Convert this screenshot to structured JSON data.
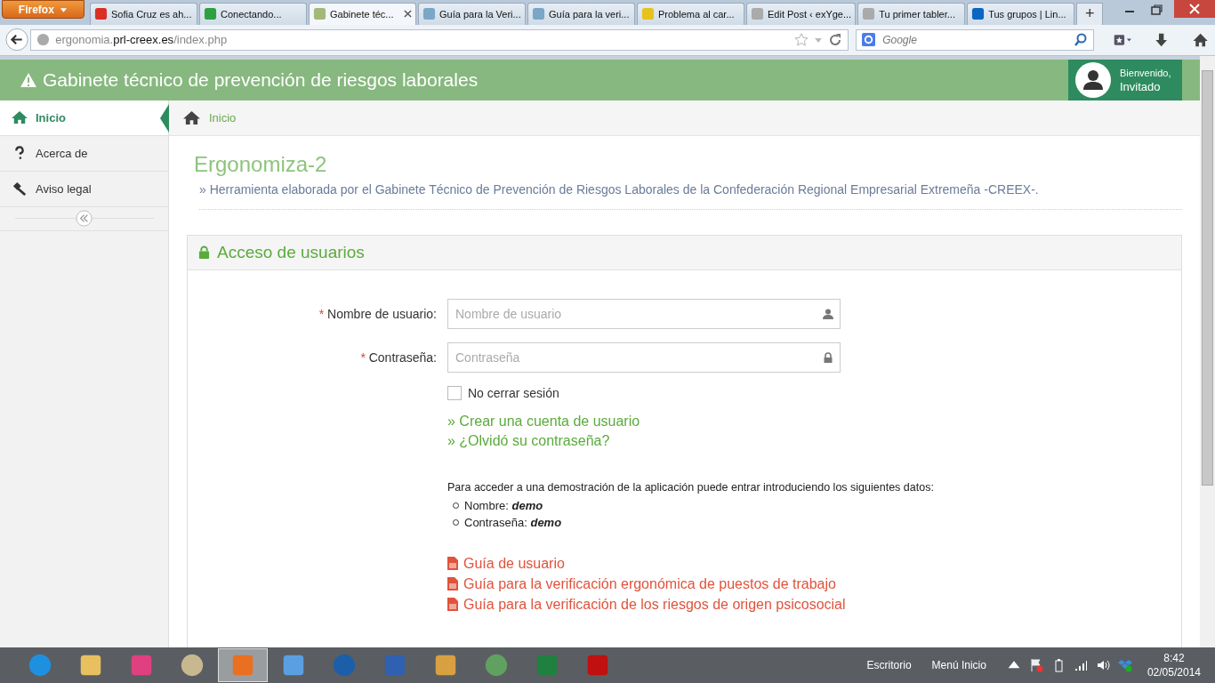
{
  "browser": {
    "menu_button": "Firefox",
    "tabs": [
      {
        "title": "Sofia Cruz es ah...",
        "selected": false
      },
      {
        "title": "Conectando...",
        "selected": false
      },
      {
        "title": "Gabinete téc...",
        "selected": true
      },
      {
        "title": "Guía para la Veri...",
        "selected": false
      },
      {
        "title": "Guía para la veri...",
        "selected": false
      },
      {
        "title": "Problema al car...",
        "selected": false
      },
      {
        "title": "Edit Post ‹ exYge...",
        "selected": false
      },
      {
        "title": "Tu primer tabler...",
        "selected": false
      },
      {
        "title": "Tus grupos | Lin...",
        "selected": false
      }
    ],
    "new_tab": "+",
    "url": "ergonomia.**prl-creex.es**/index.php",
    "search_placeholder": "Google"
  },
  "page": {
    "header": "Gabinete técnico de prevención de riesgos laborales",
    "user": {
      "greeting": "Bienvenido,",
      "name": "Invitado"
    },
    "sidebar": [
      {
        "label": "Inicio",
        "selected": true
      },
      {
        "label": "Acerca de",
        "selected": false
      },
      {
        "label": "Aviso legal",
        "selected": false
      }
    ],
    "breadcrumb": "Inicio",
    "title": "Ergonomiza-2",
    "subtitle": "» Herramienta elaborada por el Gabinete Técnico de Prevención de Riesgos Laborales de la Confederación Regional Empresarial Extremeña -CREEX-.",
    "panel_title": "Acceso de usuarios",
    "fields": [
      {
        "required_mark": "*",
        "label": "Nombre de usuario:",
        "placeholder": "Nombre de usuario"
      },
      {
        "required_mark": "*",
        "label": "Contraseña:",
        "placeholder": "Contraseña"
      }
    ],
    "remember": {
      "label": "No cerrar sesión",
      "checked": false
    },
    "links": [
      "» Crear una cuenta de usuario",
      "» ¿Olvidó su contraseña?"
    ],
    "demo_intro": "Para acceder a una demostración de la aplicación puede entrar introduciendo los siguientes datos:",
    "demo_items": [
      {
        "label": "Nombre:",
        "value": "demo"
      },
      {
        "label": "Contraseña:",
        "value": "demo"
      }
    ],
    "guides": [
      "Guía de usuario",
      "Guía para la verificación ergonómica de puestos de trabajo",
      "Guía para la verificación de los riesgos de origen psicosocial"
    ]
  },
  "taskbar": {
    "apps": [
      {
        "selected": false
      },
      {
        "selected": false
      },
      {
        "selected": false
      },
      {
        "selected": false
      },
      {
        "selected": true
      },
      {
        "selected": false
      },
      {
        "selected": false
      },
      {
        "selected": false
      },
      {
        "selected": false
      },
      {
        "selected": false
      },
      {
        "selected": false
      },
      {
        "selected": false
      }
    ],
    "toolbars": [
      "Escritorio",
      "Menú Inicio"
    ],
    "time": "8:42",
    "date": "02/05/2014"
  }
}
